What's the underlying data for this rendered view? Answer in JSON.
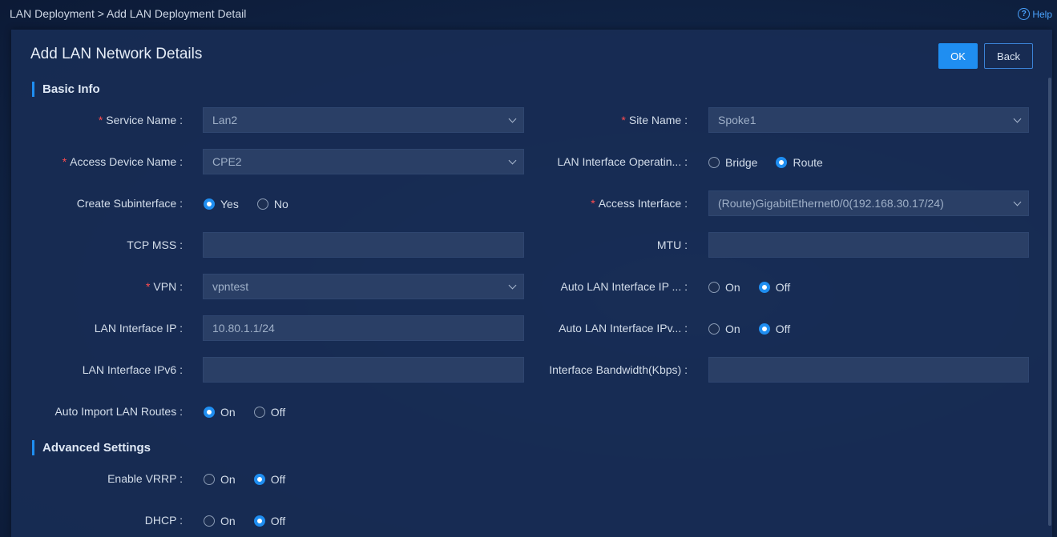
{
  "breadcrumb": "LAN Deployment > Add LAN Deployment Detail",
  "help_label": "Help",
  "dialog": {
    "title": "Add LAN Network Details",
    "ok_label": "OK",
    "back_label": "Back"
  },
  "sections": {
    "basic": "Basic Info",
    "advanced": "Advanced Settings"
  },
  "fields": {
    "service_name": {
      "label": "Service Name :",
      "value": "Lan2"
    },
    "site_name": {
      "label": "Site Name :",
      "value": "Spoke1"
    },
    "access_device_name": {
      "label": "Access Device Name :",
      "value": "CPE2"
    },
    "lan_interface_mode": {
      "label": "LAN Interface Operatin... :",
      "options": [
        "Bridge",
        "Route"
      ],
      "selected": "Route"
    },
    "create_subinterface": {
      "label": "Create Subinterface :",
      "options": [
        "Yes",
        "No"
      ],
      "selected": "Yes"
    },
    "access_interface": {
      "label": "Access Interface :",
      "value": "(Route)GigabitEthernet0/0(192.168.30.17/24)"
    },
    "tcp_mss": {
      "label": "TCP MSS :",
      "value": ""
    },
    "mtu": {
      "label": "MTU :",
      "value": ""
    },
    "vpn": {
      "label": "VPN :",
      "value": "vpntest"
    },
    "auto_lan_ip": {
      "label": "Auto LAN Interface IP ... :",
      "options": [
        "On",
        "Off"
      ],
      "selected": "Off"
    },
    "lan_interface_ip": {
      "label": "LAN Interface IP :",
      "value": "10.80.1.1/24"
    },
    "auto_lan_ipv6": {
      "label": "Auto LAN Interface IPv... :",
      "options": [
        "On",
        "Off"
      ],
      "selected": "Off"
    },
    "lan_interface_ipv6": {
      "label": "LAN Interface IPv6 :",
      "value": ""
    },
    "interface_bandwidth": {
      "label": "Interface Bandwidth(Kbps) :",
      "value": ""
    },
    "auto_import_routes": {
      "label": "Auto Import LAN Routes :",
      "options": [
        "On",
        "Off"
      ],
      "selected": "On"
    },
    "enable_vrrp": {
      "label": "Enable VRRP :",
      "options": [
        "On",
        "Off"
      ],
      "selected": "Off"
    },
    "dhcp": {
      "label": "DHCP :",
      "options": [
        "On",
        "Off"
      ],
      "selected": "Off"
    }
  },
  "colors": {
    "accent": "#1f8ef1",
    "required": "#ff4d4f"
  }
}
